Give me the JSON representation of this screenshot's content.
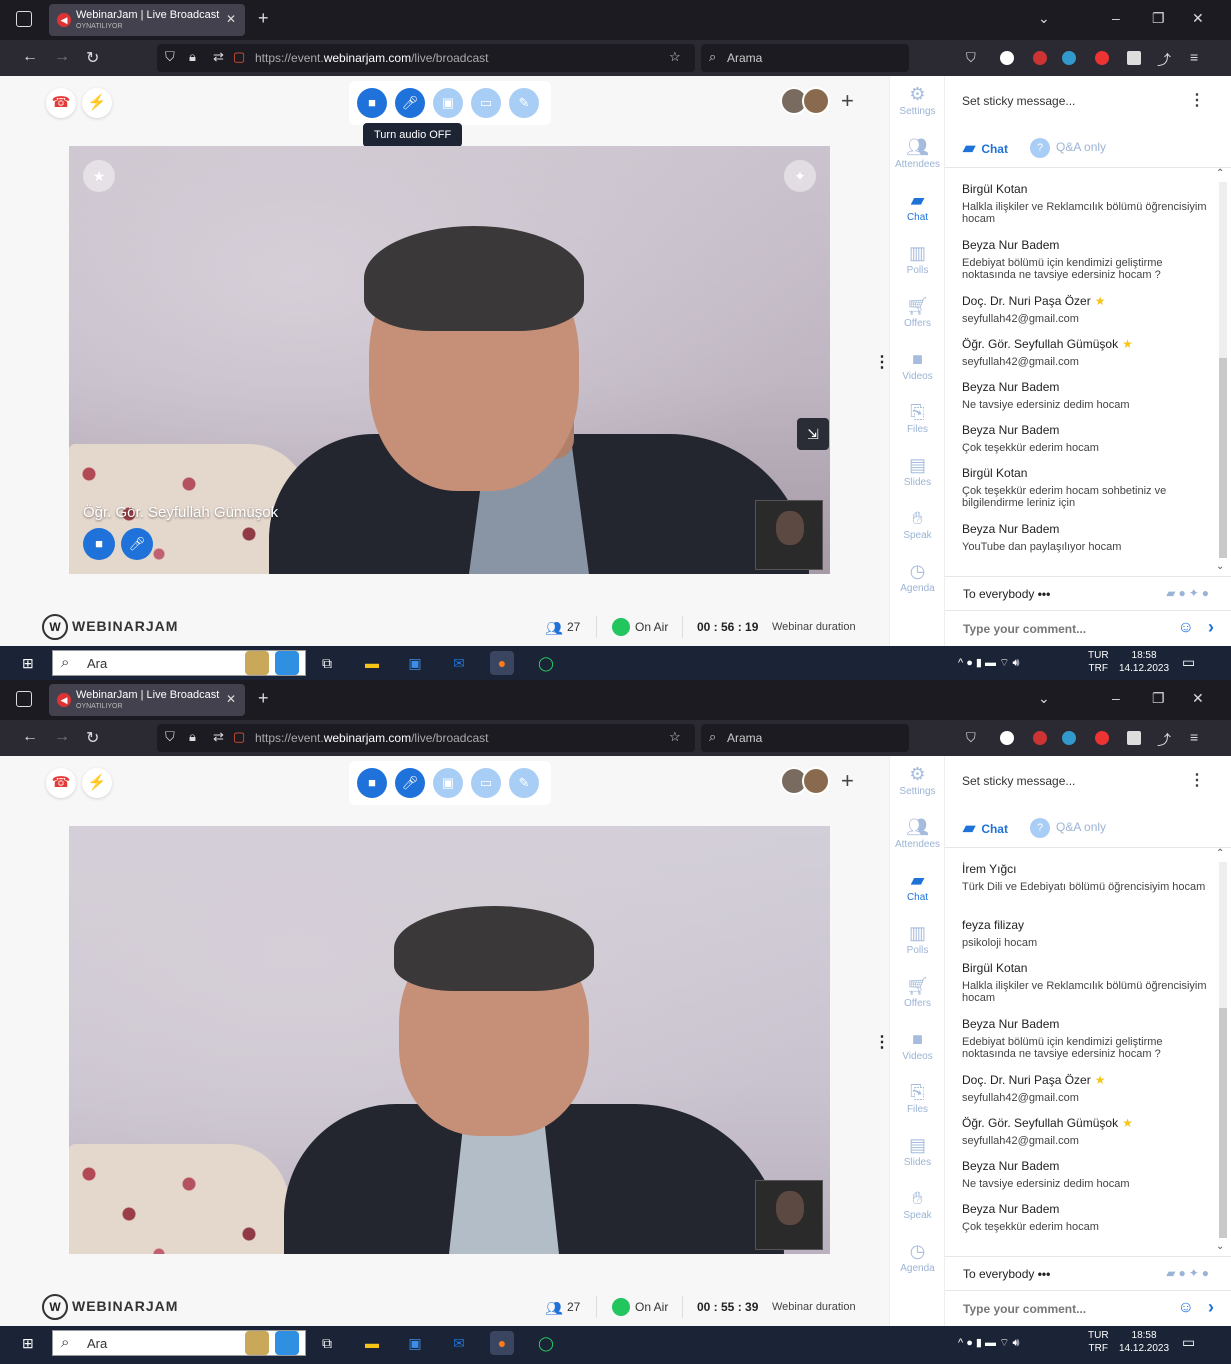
{
  "screens": [
    {
      "browser": {
        "tab_title": "WebinarJam | Live Broadcast",
        "tab_subtitle": "OYNATILIYOR",
        "url_prefix": "https://event.",
        "url_domain": "webinarjam.com",
        "url_path": "/live/broadcast",
        "search_placeholder": "Arama"
      },
      "tooltip": "Turn audio OFF",
      "presenter_name": "Öğr. Gör. Seyfullah Gümüşok",
      "logo": "WEBINARJAM",
      "attendee_count": "27",
      "on_air_label": "On Air",
      "duration": "00 : 56 : 19",
      "duration_label": "Webinar duration",
      "sticky_placeholder": "Set sticky message...",
      "tab_chat": "Chat",
      "tab_qa": "Q&A only",
      "recipient": "To everybody",
      "comment_placeholder": "Type your comment...",
      "rail": [
        "Settings",
        "Attendees",
        "Chat",
        "Polls",
        "Offers",
        "Videos",
        "Files",
        "Slides",
        "Speak",
        "Agenda"
      ],
      "messages": [
        {
          "name": "Birgül Kotan",
          "text": "Halkla ilişkiler ve Reklamcılık bölümü öğrencisiyim hocam",
          "star": false
        },
        {
          "name": "Beyza Nur Badem",
          "text": "Edebiyat bölümü için kendimizi geliştirme noktasında ne tavsiye edersiniz hocam ?",
          "star": false
        },
        {
          "name": "Doç. Dr. Nuri Paşa Özer",
          "text": "seyfullah42@gmail.com",
          "star": true
        },
        {
          "name": "Öğr. Gör. Seyfullah Gümüşok",
          "text": "seyfullah42@gmail.com",
          "star": true
        },
        {
          "name": "Beyza Nur Badem",
          "text": "Ne tavsiye edersiniz dedim hocam",
          "star": false
        },
        {
          "name": "Beyza Nur Badem",
          "text": "Çok teşekkür ederim hocam",
          "star": false
        },
        {
          "name": "Birgül Kotan",
          "text": "Çok teşekkür ederim hocam sohbetiniz ve bilgilendirme leriniz için",
          "star": false
        },
        {
          "name": "Beyza Nur Badem",
          "text": "YouTube dan paylaşılıyor hocam",
          "star": false
        }
      ],
      "taskbar": {
        "search": "Ara",
        "lang1": "TUR",
        "lang2": "TRF",
        "time": "18:58",
        "date": "14.12.2023"
      }
    },
    {
      "browser": {
        "tab_title": "WebinarJam | Live Broadcast",
        "tab_subtitle": "OYNATILIYOR",
        "url_prefix": "https://event.",
        "url_domain": "webinarjam.com",
        "url_path": "/live/broadcast",
        "search_placeholder": "Arama"
      },
      "logo": "WEBINARJAM",
      "attendee_count": "27",
      "on_air_label": "On Air",
      "duration": "00 : 55 : 39",
      "duration_label": "Webinar duration",
      "sticky_placeholder": "Set sticky message...",
      "tab_chat": "Chat",
      "tab_qa": "Q&A only",
      "recipient": "To everybody",
      "comment_placeholder": "Type your comment...",
      "rail": [
        "Settings",
        "Attendees",
        "Chat",
        "Polls",
        "Offers",
        "Videos",
        "Files",
        "Slides",
        "Speak",
        "Agenda"
      ],
      "messages": [
        {
          "name": "İrem Yığcı",
          "text": "Türk Dili ve Edebiyatı bölümü öğrencisiyim hocam",
          "star": false
        },
        {
          "name": "feyza filizay",
          "text": "psikoloji hocam",
          "star": false
        },
        {
          "name": "Birgül Kotan",
          "text": "Halkla ilişkiler ve Reklamcılık bölümü öğrencisiyim hocam",
          "star": false
        },
        {
          "name": "Beyza Nur Badem",
          "text": "Edebiyat bölümü için kendimizi geliştirme noktasında ne tavsiye edersiniz hocam ?",
          "star": false
        },
        {
          "name": "Doç. Dr. Nuri Paşa Özer",
          "text": "seyfullah42@gmail.com",
          "star": true
        },
        {
          "name": "Öğr. Gör. Seyfullah Gümüşok",
          "text": "seyfullah42@gmail.com",
          "star": true
        },
        {
          "name": "Beyza Nur Badem",
          "text": "Ne tavsiye edersiniz dedim hocam",
          "star": false
        },
        {
          "name": "Beyza Nur Badem",
          "text": "Çok teşekkür ederim hocam",
          "star": false
        }
      ],
      "taskbar": {
        "search": "Ara",
        "lang1": "TUR",
        "lang2": "TRF",
        "time": "18:58",
        "date": "14.12.2023"
      }
    }
  ],
  "colors": {
    "accent": "#1e72d9",
    "on_air": "#22c55e",
    "taskbar": "#1b2436"
  }
}
